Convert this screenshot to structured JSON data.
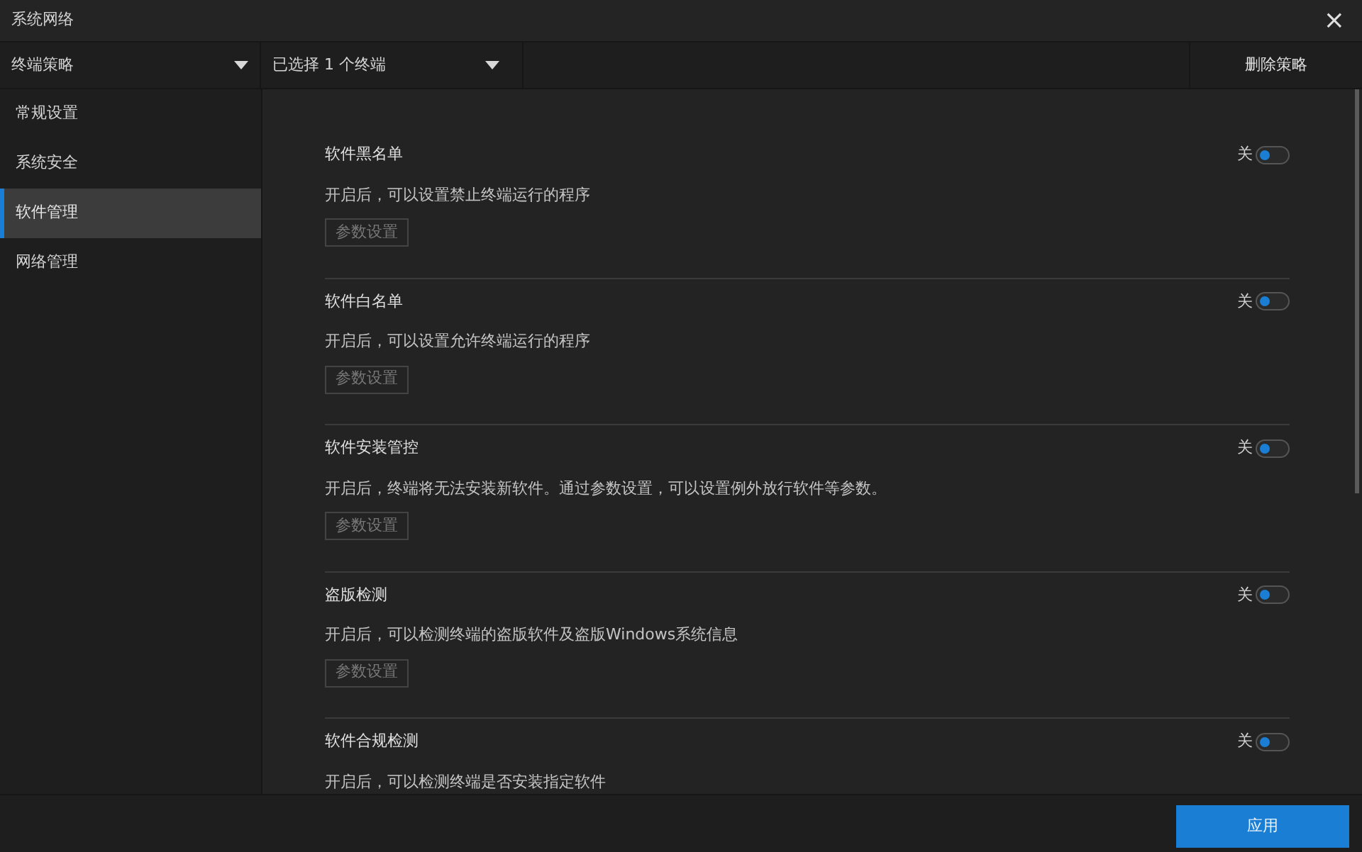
{
  "window": {
    "title": "系统网络",
    "close": "×"
  },
  "header": {
    "policy_select": "终端策略",
    "terminal_select": "已选择 1 个终端",
    "delete_button": "删除策略"
  },
  "sidebar": {
    "items": [
      {
        "label": "常规设置",
        "selected": false
      },
      {
        "label": "系统安全",
        "selected": false
      },
      {
        "label": "软件管理",
        "selected": true
      },
      {
        "label": "网络管理",
        "selected": false
      }
    ]
  },
  "sections": [
    {
      "title": "软件黑名单",
      "description": "开启后，可以设置禁止终端运行的程序",
      "toggle_label": "关",
      "on": false,
      "button": "参数设置"
    },
    {
      "title": "软件白名单",
      "description": "开启后，可以设置允许终端运行的程序",
      "toggle_label": "关",
      "on": false,
      "button": "参数设置"
    },
    {
      "title": "软件安装管控",
      "description": "开启后，终端将无法安装新软件。通过参数设置，可以设置例外放行软件等参数。",
      "toggle_label": "关",
      "on": false,
      "button": "参数设置"
    },
    {
      "title": "盗版检测",
      "description": "开启后，可以检测终端的盗版软件及盗版Windows系统信息",
      "toggle_label": "关",
      "on": false,
      "button": "参数设置"
    },
    {
      "title": "软件合规检测",
      "description": "开启后，可以检测终端是否安装指定软件",
      "toggle_label": "关",
      "on": false
    }
  ],
  "footer": {
    "apply_button": "应用"
  }
}
